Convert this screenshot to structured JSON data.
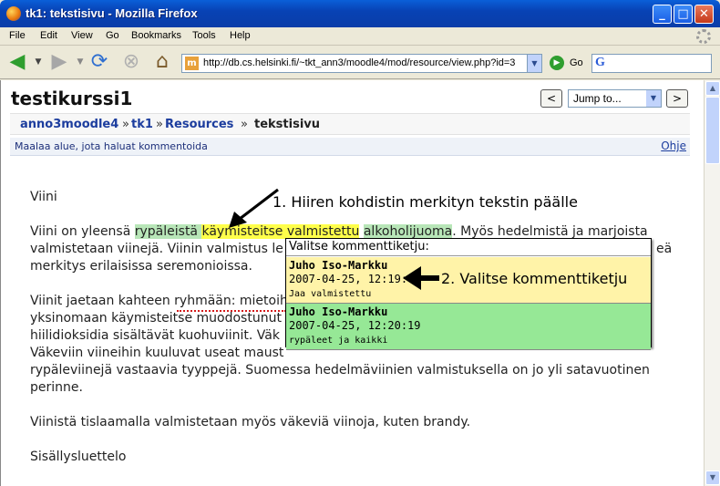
{
  "window": {
    "title": "tk1: tekstisivu - Mozilla Firefox",
    "buttons": {
      "minimize": "_",
      "maximize": "□",
      "close": "✕"
    }
  },
  "menu": [
    "File",
    "Edit",
    "View",
    "Go",
    "Bookmarks",
    "Tools",
    "Help"
  ],
  "toolbar": {
    "url": "http://db.cs.helsinki.fi/~tkt_ann3/moodle4/mod/resource/view.php?id=3",
    "go_label": "Go",
    "favicon": "m",
    "search_icon": "G"
  },
  "page": {
    "course_title": "testikurssi1",
    "jump_label": "Jump to...",
    "prev": "<",
    "next": ">",
    "breadcrumb": {
      "home": "anno3moodle4",
      "sep1": "»",
      "course": "tk1",
      "sep2": "»",
      "section": "Resources",
      "sep3": "»",
      "current": "tekstisivu"
    },
    "hint": "Maalaa alue, jota haluat kommentoida",
    "help": "Ohje",
    "content": {
      "heading": "Viini",
      "p1_line1_a": "Viini on yleensä ",
      "p1_line1_green1": "rypäleistä ",
      "p1_line1_yellow": "käymisteitse valmistettu",
      "p1_line1_space": " ",
      "p1_line1_green2": "alkoholijuoma",
      "p1_line1_b": ". Myös hedelmistä ja marjoista",
      "p1_line2_a": "valmistetaan viinejä. Viinin valmistus le",
      "p1_line2_b": "eä",
      "p1_line3_a": "merkitys erilaisissa seremonioissa.",
      "p2_line1": "Viinit jaetaan kahteen ryhmään: mietoih",
      "p2_line2": "yksinomaan käymisteitse muodostunut",
      "p2_line3": "hiilidioksidia sisältävät kuohuviinit. Väk",
      "p2_line4": "Väkeviin viineihin kuuluvat useat maust",
      "p2_line5": "rypäleviinejä vastaavia tyyppejä. Suomessa hedelmäviinien valmistuksella on jo yli satavuotinen",
      "p2_line6": "perinne.",
      "p3": "Viinistä tislaamalla valmistetaan myös väkeviä viinoja, kuten brandy.",
      "p4": "Sisällysluettelo"
    },
    "annotation1": "1. Hiiren kohdistin merkityn tekstin päälle",
    "annotation2": "2. Valitse kommenttiketju",
    "popup": {
      "header": "Valitse kommenttiketju:",
      "threads": [
        {
          "author": "Juho Iso-Markku",
          "date": "2007-04-25, 12:19:",
          "text": "Jaa valmistettu"
        },
        {
          "author": "Juho Iso-Markku",
          "date": "2007-04-25, 12:20:19",
          "text": "rypäleet ja kaikki"
        }
      ]
    }
  },
  "colors": {
    "titlebar": "#0842b4",
    "highlight_green": "#b8e6b8",
    "highlight_yellow": "#ffff4a",
    "thread1_bg": "#fff3a8",
    "thread2_bg": "#96e896",
    "link": "#1c3d9e"
  },
  "icons": {
    "back": "back-arrow-icon",
    "forward": "forward-arrow-icon",
    "reload": "reload-icon",
    "stop": "stop-icon",
    "home": "home-icon",
    "go": "go-icon",
    "pointer_arrow_1": "arrow-pointer-icon",
    "pointer_arrow_2": "arrow-left-icon"
  }
}
